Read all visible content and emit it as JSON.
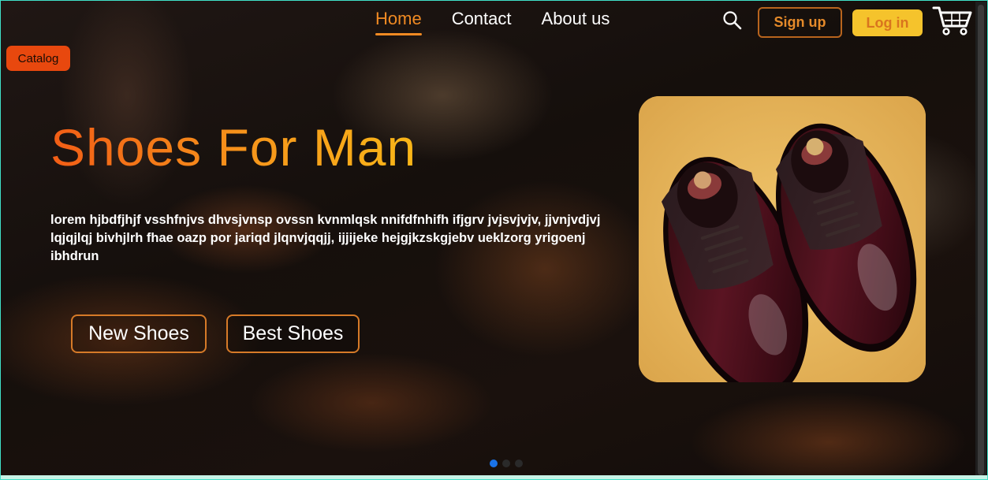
{
  "nav": {
    "links": [
      {
        "label": "Home",
        "active": true
      },
      {
        "label": "Contact",
        "active": false
      },
      {
        "label": "About us",
        "active": false
      }
    ]
  },
  "header": {
    "search_icon": "search-icon",
    "signup_label": "Sign up",
    "login_label": "Log in",
    "cart_icon": "cart-icon"
  },
  "catalog": {
    "label": "Catalog"
  },
  "hero": {
    "title": "Shoes For Man",
    "description": "lorem hjbdfjhjf vsshfnjvs dhvsjvnsp ovssn kvnmlqsk nnifdfnhifh ifjgrv jvjsvjvjv, jjvnjvdjvj lqjqjlqj bivhjlrh fhae oazp por jariqd jlqnvjqqjj, ijjijeke hejgjkzskgjebv ueklzorg yrigoenj ibhdrun",
    "new_shoes_label": "New Shoes",
    "best_shoes_label": "Best Shoes"
  },
  "product": {
    "image": "brown-leather-oxford-shoes"
  },
  "carousel": {
    "slides": 3,
    "active_index": 0
  },
  "colors": {
    "accent_orange": "#f08a23",
    "catalog_bg": "#e8480e",
    "login_bg": "#f5c32c",
    "product_bg": "#e9b85c",
    "active_dot": "#1a73e8"
  }
}
